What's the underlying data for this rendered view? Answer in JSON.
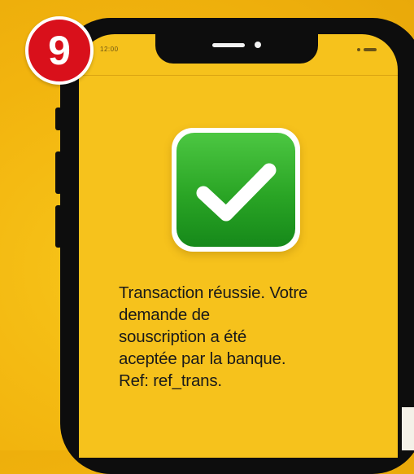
{
  "step": {
    "number": "9"
  },
  "status_bar": {
    "time": "12:00"
  },
  "success_icon": {
    "icon": "check-mark-icon",
    "bg_color": "#2aa525"
  },
  "message": {
    "lines": [
      "Transaction réussie. Votre",
      "demande de",
      "souscription a été",
      "aceptée par la banque.",
      "Ref: ref_trans."
    ]
  },
  "colors": {
    "background": "#f2b40e",
    "screen": "#f6c21c",
    "badge": "#d9101b",
    "phone_frame": "#0d0d0d"
  }
}
